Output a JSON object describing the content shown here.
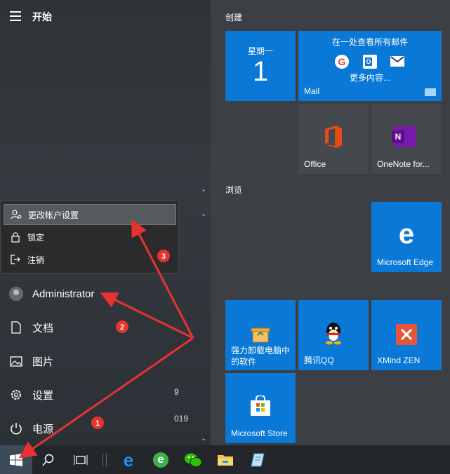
{
  "start": {
    "title": "开始"
  },
  "account_menu": {
    "items": [
      {
        "label": "更改帐户设置",
        "icon": "account-settings-icon"
      },
      {
        "label": "锁定",
        "icon": "lock-icon"
      },
      {
        "label": "注销",
        "icon": "sign-out-icon"
      }
    ]
  },
  "rail": {
    "user": "Administrator",
    "documents": "文档",
    "pictures": "图片",
    "settings": "设置",
    "power": "电源"
  },
  "side_fragments": {
    "frag1": "9",
    "frag2": "019"
  },
  "groups": {
    "create": "创建",
    "browse": "浏览"
  },
  "tiles": {
    "calendar": {
      "day": "星期一",
      "date": "1"
    },
    "mail": {
      "headline": "在一处查看所有邮件",
      "more": "更多内容...",
      "label": "Mail"
    },
    "office": {
      "label": "Office"
    },
    "onenote": {
      "label": "OneNote for..."
    },
    "edge": {
      "label": "Microsoft Edge"
    },
    "uninstaller": {
      "label_line1": "强力卸载电脑中",
      "label_line2": "的软件"
    },
    "qq": {
      "label": "腾讯QQ"
    },
    "xmind": {
      "label": "XMind ZEN"
    },
    "store": {
      "label": "Microsoft Store"
    }
  },
  "annotations": {
    "badge1": "1",
    "badge2": "2",
    "badge3": "3"
  },
  "colors": {
    "tile_blue": "#0a78d7",
    "annotation_red": "#e8322f"
  }
}
